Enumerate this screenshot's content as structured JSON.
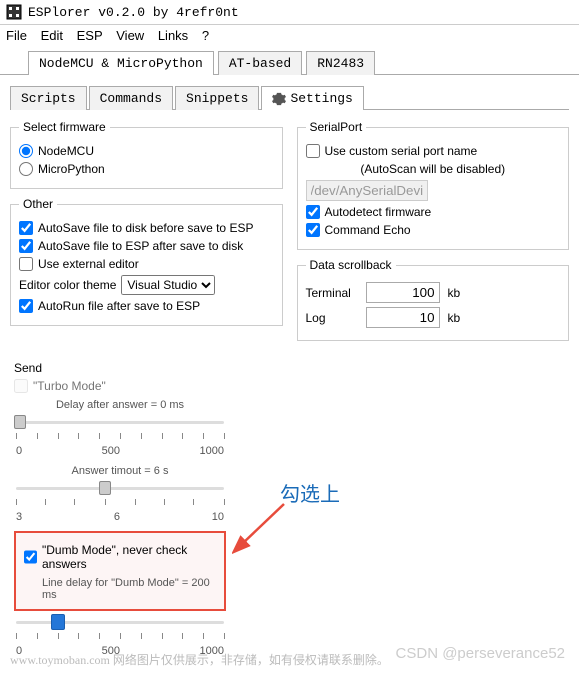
{
  "window": {
    "title": "ESPlorer v0.2.0 by 4refr0nt"
  },
  "menu": [
    "File",
    "Edit",
    "ESP",
    "View",
    "Links",
    "?"
  ],
  "tabs_top": {
    "items": [
      {
        "label": "NodeMCU & MicroPython",
        "active": true
      },
      {
        "label": "AT-based",
        "active": false
      },
      {
        "label": "RN2483",
        "active": false
      }
    ]
  },
  "tabs_inner": {
    "items": [
      {
        "label": "Scripts",
        "active": false
      },
      {
        "label": "Commands",
        "active": false
      },
      {
        "label": "Snippets",
        "active": false
      },
      {
        "label": "Settings",
        "active": true,
        "icon": "gear-icon"
      }
    ]
  },
  "firmware": {
    "legend": "Select firmware",
    "options": [
      {
        "label": "NodeMCU",
        "checked": true
      },
      {
        "label": "MicroPython",
        "checked": false
      }
    ]
  },
  "other": {
    "legend": "Other",
    "autosave_disk": {
      "label": "AutoSave file to disk before save to ESP",
      "checked": true
    },
    "autosave_esp": {
      "label": "AutoSave file to ESP after save to disk",
      "checked": true
    },
    "external_editor": {
      "label": "Use external editor",
      "checked": false
    },
    "theme_label": "Editor color theme",
    "theme_value": "Visual Studio",
    "autorun": {
      "label": "AutoRun file after save to ESP",
      "checked": true
    }
  },
  "serialport": {
    "legend": "SerialPort",
    "custom_name": {
      "label": "Use custom serial port name",
      "checked": false
    },
    "hint": "(AutoScan will be disabled)",
    "input_value": "/dev/AnySerialDevice",
    "autodetect": {
      "label": "Autodetect firmware",
      "checked": true
    },
    "echo": {
      "label": "Command Echo",
      "checked": true
    }
  },
  "scrollback": {
    "legend": "Data scrollback",
    "terminal": {
      "label": "Terminal",
      "value": "100",
      "unit": "kb"
    },
    "log": {
      "label": "Log",
      "value": "10",
      "unit": "kb"
    }
  },
  "send": {
    "label": "Send",
    "turbo": {
      "label": "\"Turbo Mode\"",
      "checked": false
    },
    "delay_caption": "Delay after answer = 0 ms",
    "timeout_caption": "Answer timout = 6 s",
    "dumb": {
      "label": "\"Dumb Mode\", never check answers",
      "checked": true
    },
    "dumb_caption": "Line delay for \"Dumb Mode\" = 200 ms",
    "scale": {
      "min": "0",
      "mid": "500",
      "max": "1000"
    },
    "scale2": {
      "min": "3",
      "mid": "6",
      "max": "10"
    }
  },
  "annotation": {
    "text": "勾选上"
  },
  "watermarks": {
    "bl": "www.toymoban.com 网络图片仅供展示，非存储，如有侵权请联系删除。",
    "br": "CSDN @perseverance52"
  }
}
